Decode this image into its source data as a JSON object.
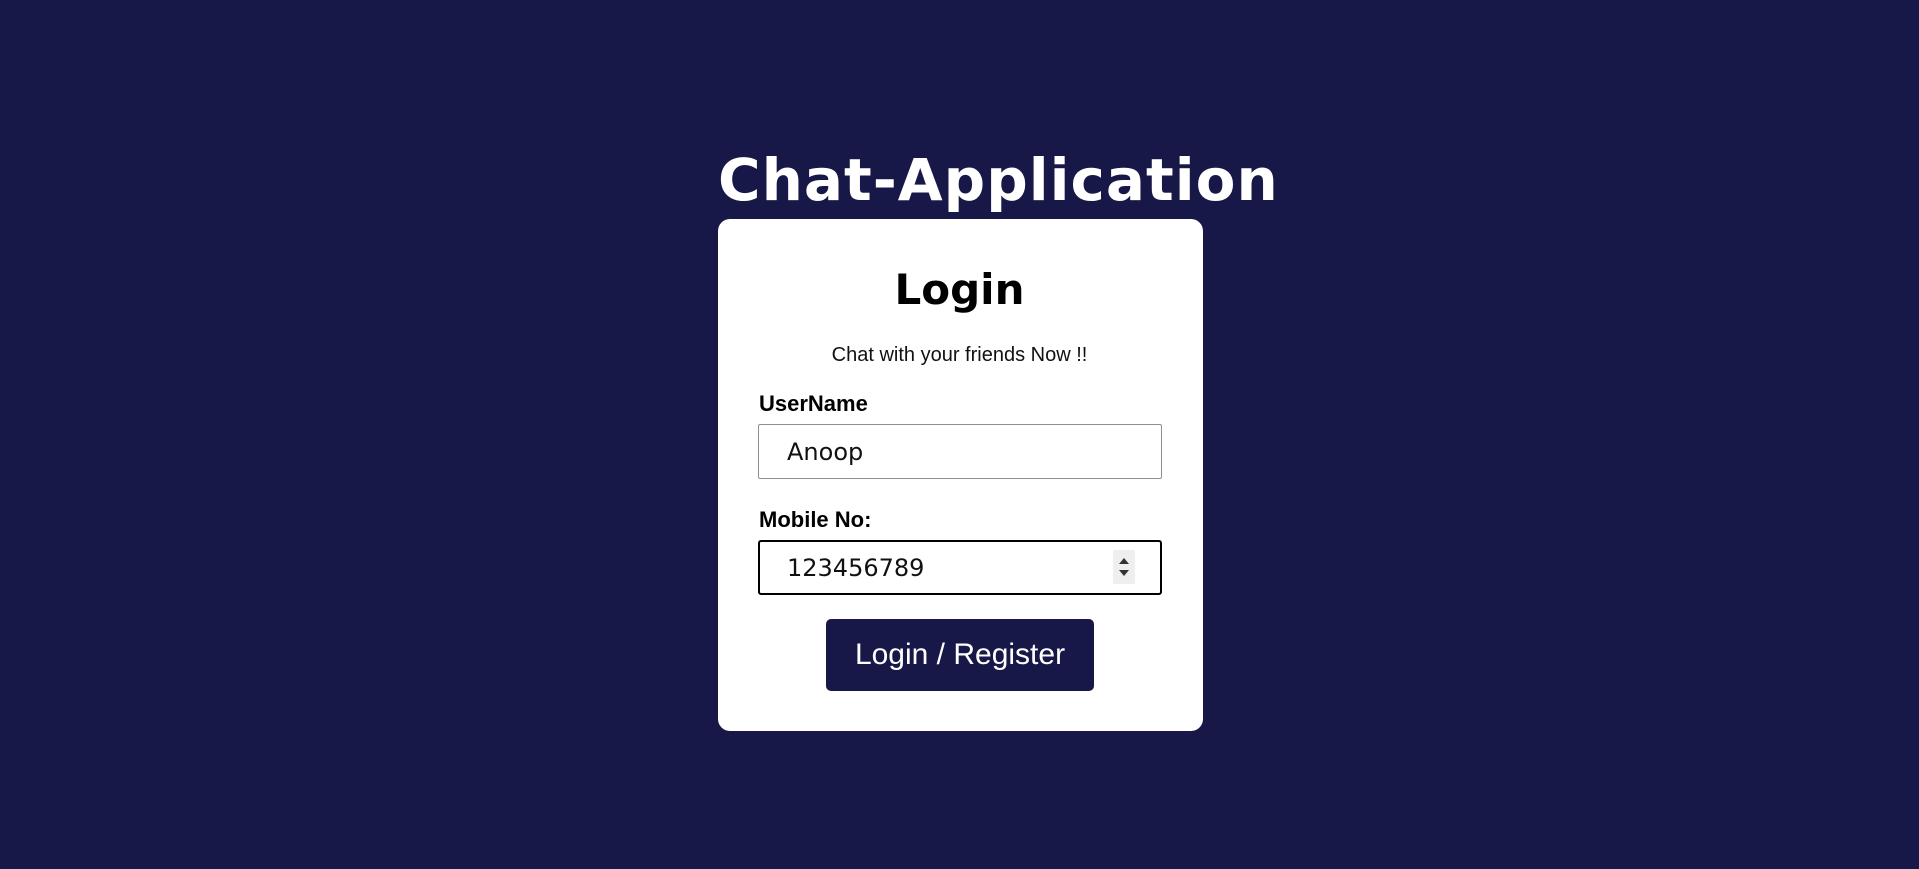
{
  "app": {
    "title": "Chat-Application"
  },
  "login_card": {
    "heading": "Login",
    "tagline": "Chat with your friends Now !!",
    "username": {
      "label": "UserName",
      "value": "Anoop"
    },
    "mobile": {
      "label": "Mobile No:",
      "value": "123456789"
    },
    "submit_label": "Login / Register"
  },
  "colors": {
    "background": "#181848",
    "card": "#ffffff",
    "button": "#181848"
  }
}
